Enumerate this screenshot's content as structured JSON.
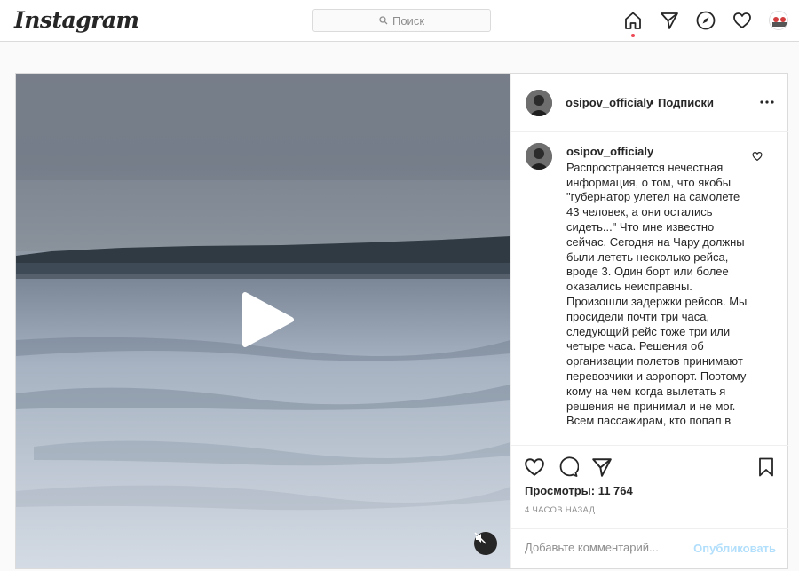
{
  "app": {
    "logo_text": "Instagram"
  },
  "search": {
    "placeholder": "Поиск",
    "icon": "search-icon"
  },
  "nav": {
    "icons": [
      "home-icon",
      "direct-icon",
      "explore-icon",
      "activity-heart-icon",
      "profile-avatar"
    ],
    "active": "home-icon",
    "notification_dot_color": "#ed4956"
  },
  "post": {
    "username": "osipov_officialy",
    "follow_separator": "•",
    "follow_label": "Подписки",
    "more_label": "•••",
    "caption": "Распространяется нечестная информация, о том, что якобы \"губернатор улетел на самолете 43 человек, а они остались сидеть...\" Что мне известно сейчас. Сегодня на Чару должны были лететь несколько рейса, вроде 3. Один борт или более оказались неисправны. Произошли задержки рейсов. Мы просидели почти три часа, следующий рейс тоже три или четыре часа. Решения об организации полетов принимают перевозчики и аэропорт. Поэтому кому на чем когда вылетать я решения не принимал и не мог. Всем пассажирам, кто попал в",
    "views_label": "Просмотры: 11 764",
    "time_label": "4 ЧАСОВ НАЗАД",
    "comment_placeholder": "Добавьте комментарий...",
    "publish_label": "Опубликовать",
    "publish_color": "#b2dffc"
  }
}
